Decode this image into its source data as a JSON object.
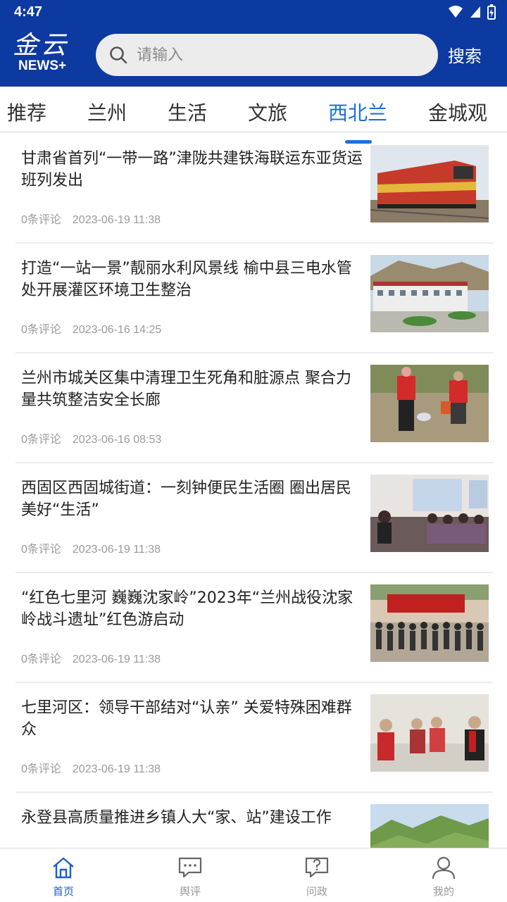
{
  "status_bar": {
    "time": "4:47"
  },
  "header": {
    "logo_cn": "金云",
    "logo_en": "NEWS+",
    "search_placeholder": "请输入",
    "search_button": "搜索"
  },
  "tabs": [
    {
      "label": "推荐"
    },
    {
      "label": "兰州"
    },
    {
      "label": "生活"
    },
    {
      "label": "文旅"
    },
    {
      "label": "西北兰",
      "active": true
    },
    {
      "label": "金城观"
    }
  ],
  "news": [
    {
      "title": "甘肃省首列“一带一路”津陇共建铁海联运东亚货运班列发出",
      "comments": "0条评论",
      "time": "2023-06-19 11:38",
      "thumb": "train"
    },
    {
      "title": "打造“一站一景”靓丽水利风景线 榆中县三电水管处开展灌区环境卫生整治",
      "comments": "0条评论",
      "time": "2023-06-16 14:25",
      "thumb": "building"
    },
    {
      "title": "兰州市城关区集中清理卫生死角和脏源点 聚合力量共筑整洁安全长廊",
      "comments": "0条评论",
      "time": "2023-06-16 08:53",
      "thumb": "volunteers"
    },
    {
      "title": "西固区西固城街道：一刻钟便民生活圈 圈出居民美好“生活”",
      "comments": "0条评论",
      "time": "2023-06-19 11:38",
      "thumb": "music-room"
    },
    {
      "title": "“红色七里河 巍巍沈家岭”2023年“兰州战役沈家岭战斗遗址”红色游启动",
      "comments": "0条评论",
      "time": "2023-06-19 11:38",
      "thumb": "ceremony"
    },
    {
      "title": "七里河区：领导干部结对“认亲” 关爱特殊困难群众",
      "comments": "0条评论",
      "time": "2023-06-19 11:38",
      "thumb": "visit"
    },
    {
      "title": "永登县高质量推进乡镇人大“家、站”建设工作",
      "comments": "",
      "time": "",
      "thumb": "hills"
    }
  ],
  "bottom_nav": [
    {
      "label": "首页",
      "icon": "home-icon",
      "active": true
    },
    {
      "label": "舆评",
      "icon": "comment-icon"
    },
    {
      "label": "问政",
      "icon": "question-icon"
    },
    {
      "label": "我的",
      "icon": "user-icon"
    }
  ],
  "colors": {
    "primary": "#0d3aa0",
    "accent": "#1d6fe0"
  }
}
